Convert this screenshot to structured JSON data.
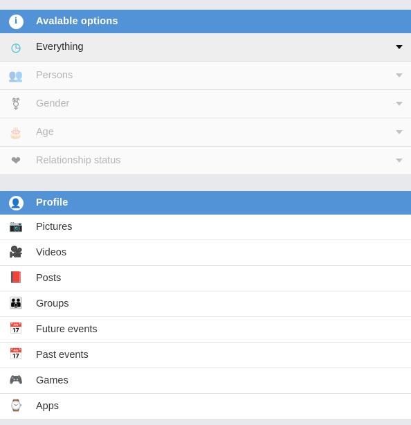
{
  "colors": {
    "header_blue": "#5293d8",
    "page_background": "#e7e9ec",
    "active_row": "#eeeeee",
    "disabled_row": "#fafafa",
    "row_white": "#ffffff",
    "clock_accent": "#1fb6d6"
  },
  "available_options": {
    "header": {
      "title": "Avalable options",
      "icon": "info-circle-icon"
    },
    "rows": [
      {
        "label": "Everything",
        "icon": "clock-icon",
        "icon_glyph": "◷",
        "state": "active",
        "caret": "▼"
      },
      {
        "label": "Persons",
        "icon": "busts-in-silhouette-icon",
        "icon_glyph": "👥",
        "state": "disabled",
        "caret": "▼"
      },
      {
        "label": "Gender",
        "icon": "gender-symbols-icon",
        "icon_glyph": "⚧",
        "state": "disabled",
        "caret": "▼"
      },
      {
        "label": "Age",
        "icon": "birthday-cake-icon",
        "icon_glyph": "🎂",
        "state": "disabled",
        "caret": "▼"
      },
      {
        "label": "Relationship status",
        "icon": "heart-icon",
        "icon_glyph": "❤",
        "state": "disabled",
        "caret": "▼"
      }
    ]
  },
  "profile": {
    "header": {
      "title": "Profile",
      "icon": "person-circle-icon"
    },
    "rows": [
      {
        "label": "Pictures",
        "icon": "camera-icon",
        "icon_glyph": "📷"
      },
      {
        "label": "Videos",
        "icon": "movie-camera-icon",
        "icon_glyph": "🎥"
      },
      {
        "label": "Posts",
        "icon": "books-icon",
        "icon_glyph": "📕"
      },
      {
        "label": "Groups",
        "icon": "people-group-icon",
        "icon_glyph": "👪"
      },
      {
        "label": "Future events",
        "icon": "calendar-icon",
        "icon_glyph": "📅"
      },
      {
        "label": "Past events",
        "icon": "calendar-icon",
        "icon_glyph": "📅"
      },
      {
        "label": "Games",
        "icon": "game-controller-icon",
        "icon_glyph": "🎮"
      },
      {
        "label": "Apps",
        "icon": "watch-icon",
        "icon_glyph": "⌚"
      }
    ]
  }
}
